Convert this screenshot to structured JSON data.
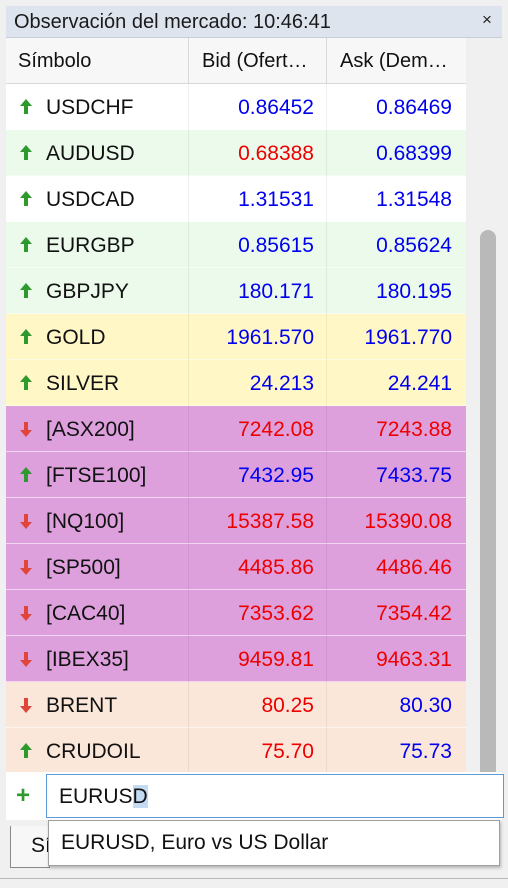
{
  "window": {
    "title": "Observación del mercado: 10:46:41",
    "close_label": "×"
  },
  "columns": {
    "symbol": "Símbolo",
    "bid": "Bid (Ofert…",
    "ask": "Ask (Dem…"
  },
  "colors": {
    "up": "#2e9a2e",
    "down": "#e0453c",
    "value_up": "#0000ee",
    "value_down": "#ee0000"
  },
  "rows": [
    {
      "symbol": "USDCHF",
      "trend": "up",
      "bid": "0.86452",
      "ask": "0.86469",
      "bid_dir": "up",
      "ask_dir": "up",
      "bg": "#ffffff"
    },
    {
      "symbol": "AUDUSD",
      "trend": "up",
      "bid": "0.68388",
      "ask": "0.68399",
      "bid_dir": "down",
      "ask_dir": "up",
      "bg": "#ebfaeb"
    },
    {
      "symbol": "USDCAD",
      "trend": "up",
      "bid": "1.31531",
      "ask": "1.31548",
      "bid_dir": "up",
      "ask_dir": "up",
      "bg": "#ffffff"
    },
    {
      "symbol": "EURGBP",
      "trend": "up",
      "bid": "0.85615",
      "ask": "0.85624",
      "bid_dir": "up",
      "ask_dir": "up",
      "bg": "#ebfaeb"
    },
    {
      "symbol": "GBPJPY",
      "trend": "up",
      "bid": "180.171",
      "ask": "180.195",
      "bid_dir": "up",
      "ask_dir": "up",
      "bg": "#ebfaeb"
    },
    {
      "symbol": "GOLD",
      "trend": "up",
      "bid": "1961.570",
      "ask": "1961.770",
      "bid_dir": "up",
      "ask_dir": "up",
      "bg": "#fff8c6"
    },
    {
      "symbol": "SILVER",
      "trend": "up",
      "bid": "24.213",
      "ask": "24.241",
      "bid_dir": "up",
      "ask_dir": "up",
      "bg": "#fff8c6"
    },
    {
      "symbol": "[ASX200]",
      "trend": "down",
      "bid": "7242.08",
      "ask": "7243.88",
      "bid_dir": "down",
      "ask_dir": "down",
      "bg": "#dda0dd"
    },
    {
      "symbol": "[FTSE100]",
      "trend": "up",
      "bid": "7432.95",
      "ask": "7433.75",
      "bid_dir": "up",
      "ask_dir": "up",
      "bg": "#dda0dd"
    },
    {
      "symbol": "[NQ100]",
      "trend": "down",
      "bid": "15387.58",
      "ask": "15390.08",
      "bid_dir": "down",
      "ask_dir": "down",
      "bg": "#dda0dd"
    },
    {
      "symbol": "[SP500]",
      "trend": "down",
      "bid": "4485.86",
      "ask": "4486.46",
      "bid_dir": "down",
      "ask_dir": "down",
      "bg": "#dda0dd"
    },
    {
      "symbol": "[CAC40]",
      "trend": "down",
      "bid": "7353.62",
      "ask": "7354.42",
      "bid_dir": "down",
      "ask_dir": "down",
      "bg": "#dda0dd"
    },
    {
      "symbol": "[IBEX35]",
      "trend": "down",
      "bid": "9459.81",
      "ask": "9463.31",
      "bid_dir": "down",
      "ask_dir": "down",
      "bg": "#dda0dd"
    },
    {
      "symbol": "BRENT",
      "trend": "down",
      "bid": "80.25",
      "ask": "80.30",
      "bid_dir": "down",
      "ask_dir": "up",
      "bg": "#fbe7da"
    },
    {
      "symbol": "CRUDOIL",
      "trend": "up",
      "bid": "75.70",
      "ask": "75.73",
      "bid_dir": "down",
      "ask_dir": "up",
      "bg": "#fbe7da"
    }
  ],
  "add_symbol": {
    "plus": "+",
    "typed": "EURUS",
    "selected": "D"
  },
  "suggestion": {
    "text": "EURUSD, Euro vs US Dollar"
  },
  "bottom_tab": {
    "label": "Símbolos"
  }
}
